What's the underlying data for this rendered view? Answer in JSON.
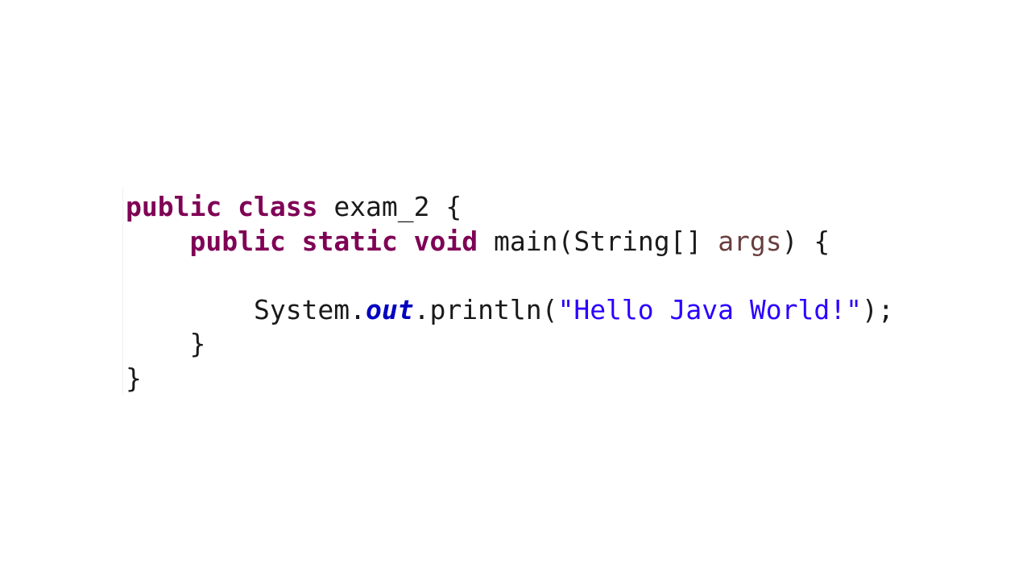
{
  "code": {
    "line1": {
      "kw1": "public",
      "kw2": "class",
      "name": "exam_2",
      "brace": "{"
    },
    "line2": {
      "kw1": "public",
      "kw2": "static",
      "kw3": "void",
      "method": "main(String[]",
      "param": "args",
      "tail": ") {"
    },
    "line3": {
      "text": ""
    },
    "line4": {
      "obj": "System.",
      "field": "out",
      "call": ".println(",
      "string": "\"Hello Java World!\"",
      "tail": ");"
    },
    "line5": {
      "brace": "}"
    },
    "line6": {
      "brace": "}"
    }
  },
  "colors": {
    "keyword": "#7f0055",
    "string": "#2a00ff",
    "field": "#0000c0",
    "parameter": "#6a3e3e",
    "text": "#1a1a1a",
    "background": "#ffffff"
  }
}
